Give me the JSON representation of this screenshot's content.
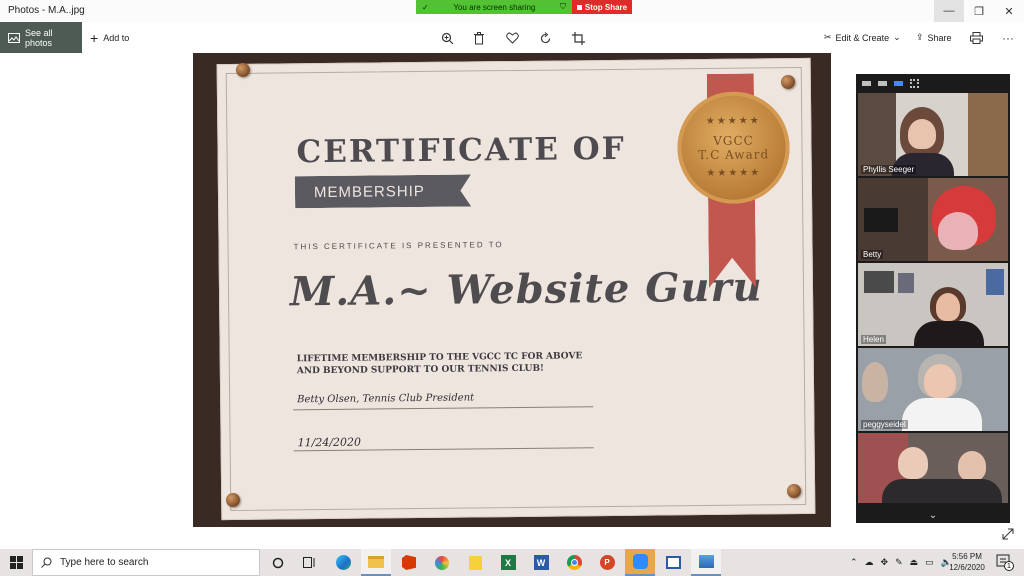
{
  "window": {
    "title": "Photos - M.A..jpg",
    "controls": {
      "minimize": "—",
      "maximize": "❐",
      "close": "✕"
    }
  },
  "screen_share": {
    "status": "You are screen sharing",
    "stop_label": "Stop Share",
    "status_color": "#52c234",
    "stop_color": "#e02b2b"
  },
  "toolbar": {
    "see_all": "See all photos",
    "add_to": "Add to",
    "edit_create": "Edit & Create",
    "share": "Share",
    "icons": [
      "zoom-icon",
      "delete-icon",
      "favorite-icon",
      "rotate-icon",
      "crop-icon",
      "print-icon",
      "more-icon"
    ]
  },
  "certificate": {
    "title": "CERTIFICATE OF",
    "subtitle": "MEMBERSHIP",
    "presented": "THIS CERTIFICATE IS PRESENTED TO",
    "name": "M.A.~ Website Guru",
    "description": "LIFETIME MEMBERSHIP TO THE VGCC TC FOR ABOVE AND BEYOND SUPPORT TO OUR TENNIS CLUB!",
    "signature": "Betty Olsen, Tennis Club President",
    "date": "11/24/2020",
    "award_line1": "VGCC",
    "award_line2": "T.C Award",
    "award_stars_top": "★★★★★",
    "award_stars_bottom": "★★★★★"
  },
  "zoom": {
    "participants": [
      {
        "name": "Phyllis Seeger"
      },
      {
        "name": "Betty"
      },
      {
        "name": "Helen"
      },
      {
        "name": "peggyseidel"
      },
      {
        "name": ""
      }
    ],
    "more_icon": "⌄"
  },
  "taskbar": {
    "search_placeholder": "Type here to search",
    "time": "5:56 PM",
    "date": "12/6/2020",
    "notification_count": "1",
    "apps": [
      "cortana",
      "task-view",
      "edge",
      "file-explorer",
      "office",
      "paint",
      "sticky-notes",
      "excel",
      "word",
      "chrome",
      "powerpoint",
      "zoom",
      "teams-meet",
      "photos"
    ]
  }
}
